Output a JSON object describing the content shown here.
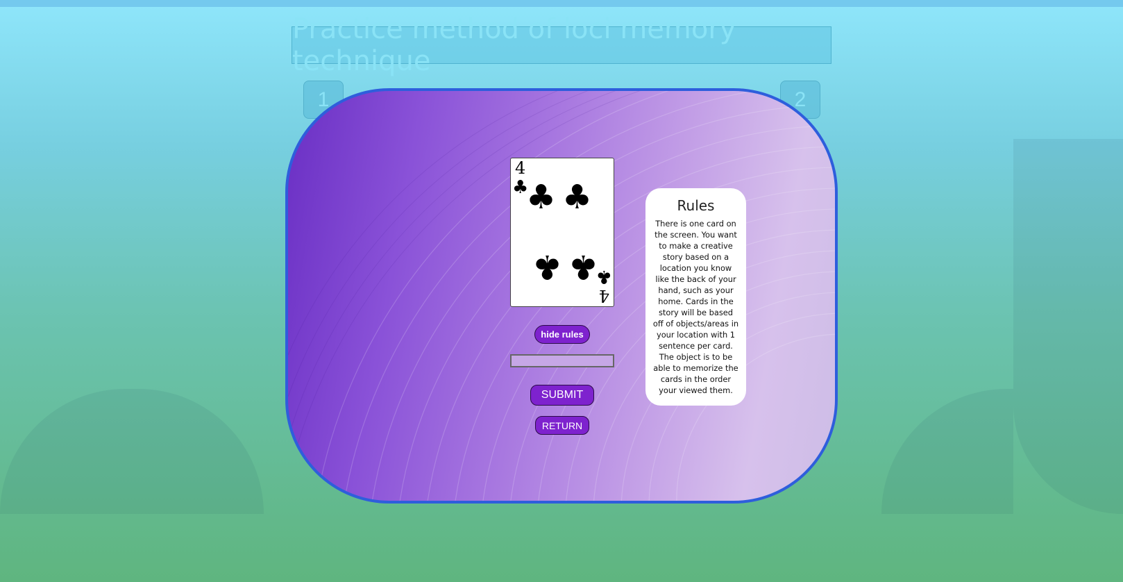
{
  "page": {
    "title": "Practice method of loci memory technique"
  },
  "nav": {
    "left_button": "1",
    "right_button": "2"
  },
  "card": {
    "rank": "4",
    "suit": "clubs",
    "suit_symbol": "♣"
  },
  "controls": {
    "hide_rules_label": "hide rules",
    "answer_input_value": "",
    "submit_label": "SUBMIT",
    "return_label": "RETURN"
  },
  "rules": {
    "heading": "Rules",
    "text": "There is one card on the screen. You want to make a creative story based on a location you know like the back of your hand, such as your home. Cards in the story will be based off of objects/areas in your location with 1 sentence per card. The object is to be able to memorize the cards in the order your viewed them."
  },
  "colors": {
    "accent": "#7e22ce",
    "panel_border": "#2e5edc",
    "title_text": "#8ae3f6"
  }
}
